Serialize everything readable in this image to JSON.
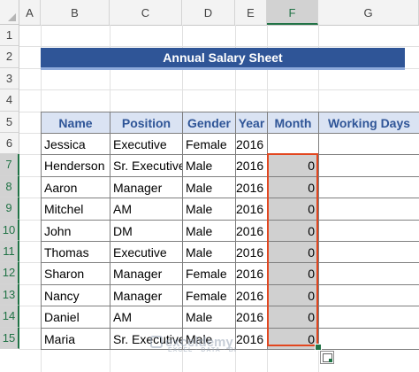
{
  "columns": [
    "A",
    "B",
    "C",
    "D",
    "E",
    "F",
    "G"
  ],
  "rows": [
    "1",
    "2",
    "3",
    "4",
    "5",
    "6",
    "7",
    "8",
    "9",
    "10",
    "11",
    "12",
    "13",
    "14",
    "15"
  ],
  "selected_column": "F",
  "title": "Annual Salary Sheet",
  "table": {
    "headers": [
      "Name",
      "Position",
      "Gender",
      "Year",
      "Month",
      "Working Days"
    ],
    "rows": [
      {
        "name": "Jessica",
        "position": "Executive",
        "gender": "Female",
        "year": "2016",
        "month": "",
        "days": ""
      },
      {
        "name": "Henderson",
        "position": "Sr. Executive",
        "gender": "Male",
        "year": "2016",
        "month": "0",
        "days": ""
      },
      {
        "name": "Aaron",
        "position": "Manager",
        "gender": "Male",
        "year": "2016",
        "month": "0",
        "days": ""
      },
      {
        "name": "Mitchel",
        "position": "AM",
        "gender": "Male",
        "year": "2016",
        "month": "0",
        "days": ""
      },
      {
        "name": "John",
        "position": "DM",
        "gender": "Male",
        "year": "2016",
        "month": "0",
        "days": ""
      },
      {
        "name": "Thomas",
        "position": "Executive",
        "gender": "Male",
        "year": "2016",
        "month": "0",
        "days": ""
      },
      {
        "name": "Sharon",
        "position": "Manager",
        "gender": "Female",
        "year": "2016",
        "month": "0",
        "days": ""
      },
      {
        "name": "Nancy",
        "position": "Manager",
        "gender": "Female",
        "year": "2016",
        "month": "0",
        "days": ""
      },
      {
        "name": "Daniel",
        "position": "AM",
        "gender": "Male",
        "year": "2016",
        "month": "0",
        "days": ""
      },
      {
        "name": "Maria",
        "position": "Sr. Executive",
        "gender": "Male",
        "year": "2016",
        "month": "0",
        "days": ""
      }
    ]
  },
  "watermark": {
    "brand": "exceldemy",
    "tagline": "EXCEL · DATA · BI"
  },
  "colors": {
    "title_bg": "#2f5597",
    "header_bg": "#dae3f3",
    "header_text": "#2f5597",
    "selection_border": "#e2461f",
    "selected_fill": "#d0d0d0",
    "excel_green": "#217346"
  }
}
